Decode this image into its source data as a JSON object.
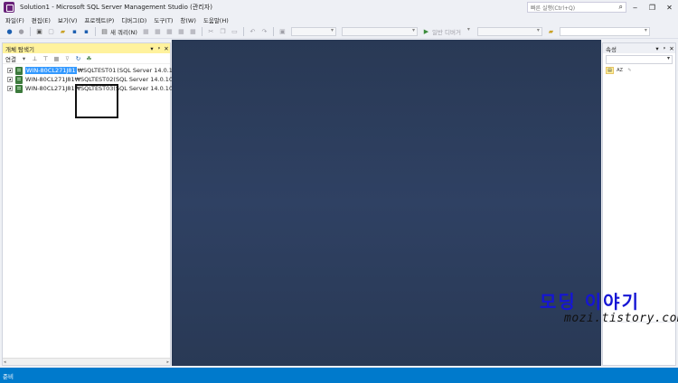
{
  "window": {
    "title": "Solution1 - Microsoft SQL Server Management Studio (관리자)",
    "quick_launch_placeholder": "빠른 실행(Ctrl+Q)",
    "buttons": [
      "‒",
      "✎",
      "—",
      "❐",
      "✕"
    ]
  },
  "menu": [
    "파일(F)",
    "편집(E)",
    "보기(V)",
    "프로젝트(P)",
    "디버그(D)",
    "도구(T)",
    "창(W)",
    "도움말(H)"
  ],
  "toolbar": {
    "new_query": "새 쿼리(N)",
    "generic_debugger": "일반 디버거"
  },
  "object_explorer": {
    "title": "개체 탐색기",
    "header_btns": [
      "▾",
      "ᵖ",
      "✕"
    ],
    "connect_label": "연결",
    "tree": [
      {
        "server": "WIN-80CL271J81",
        "instance": "₩SQLTEST01",
        "version": "(SQL Server 14.0.100",
        "selected": true
      },
      {
        "server": "WIN-80CL271J81",
        "instance": "₩SQLTEST02",
        "version": "(SQL Server 14.0.100",
        "selected": false
      },
      {
        "server": "WIN-80CL271J81",
        "instance": "₩SQLTEST03",
        "version": "(SQL Server 14.0.100",
        "selected": false
      }
    ]
  },
  "properties": {
    "title": "속성",
    "header_btns": [
      "▾",
      "ᵖ",
      "✕"
    ]
  },
  "watermark": {
    "title": "모딩 이야기",
    "url": "mozi.tistory.com"
  },
  "status": {
    "text": "준비"
  },
  "colors": {
    "accent": "#007acc",
    "panel_highlight": "#fff29d",
    "document_well": "#293955",
    "selection": "#3399ff"
  }
}
